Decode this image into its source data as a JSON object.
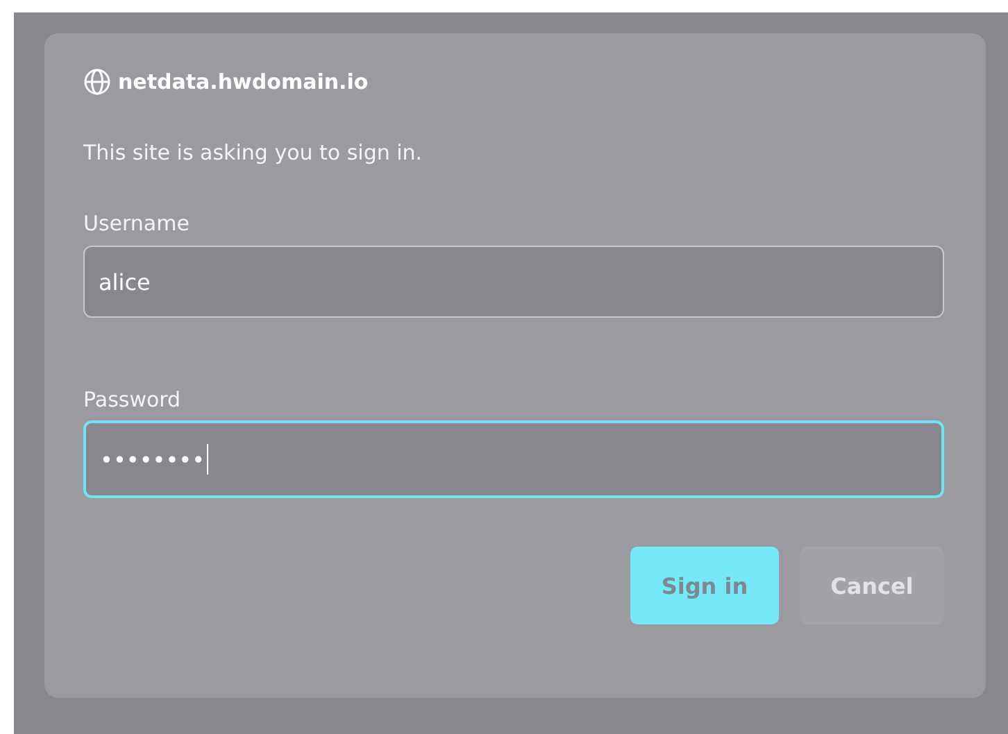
{
  "dialog": {
    "host": "netdata.hwdomain.io",
    "message": "This site is asking you to sign in.",
    "fields": [
      {
        "label": "Username",
        "value": "alice",
        "focused": false
      },
      {
        "label": "Password",
        "value": "••••••••",
        "focused": true
      }
    ],
    "buttons": [
      {
        "label": "Sign in",
        "kind": "primary"
      },
      {
        "label": "Cancel",
        "kind": "secondary"
      }
    ]
  }
}
